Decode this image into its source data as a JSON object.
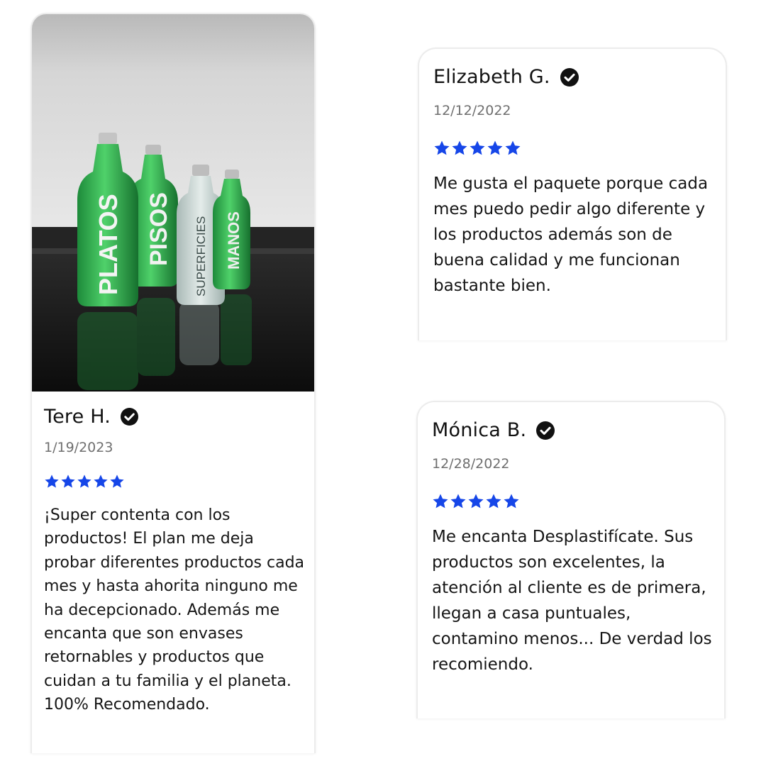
{
  "colors": {
    "star": "#1646e8",
    "check": "#111111"
  },
  "reviews": [
    {
      "name": "Tere H.",
      "date": "1/19/2023",
      "rating": 5,
      "text": "¡Super contenta con los productos! El plan me deja probar diferentes productos cada mes y hasta ahorita ninguno me ha decepcionado. Además me encanta que son envases retornables y productos que cuidan a tu familia y el planeta. 100% Recomendado.",
      "photo": {
        "bottles": [
          "PLATOS",
          "PISOS",
          "SUPERFICIES",
          "MANOS"
        ]
      }
    },
    {
      "name": "Elizabeth G.",
      "date": "12/12/2022",
      "rating": 5,
      "text": "Me gusta el paquete porque cada mes puedo pedir algo diferente y los productos además son de buena calidad y me funcionan bastante bien."
    },
    {
      "name": "Mónica B.",
      "date": "12/28/2022",
      "rating": 5,
      "text": "Me encanta Desplastifícate. Sus productos son excelentes, la atención al cliente es de primera, llegan a casa puntuales, contamino menos... De verdad los recomiendo."
    }
  ]
}
